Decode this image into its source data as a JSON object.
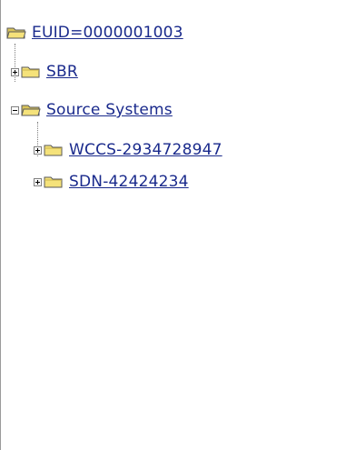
{
  "tree": {
    "root": {
      "label": "EUID=0000001003",
      "icon": "open-folder-icon"
    },
    "sbr": {
      "label": "SBR",
      "icon": "folder-icon",
      "toggle": "plus"
    },
    "source_systems": {
      "label": "Source Systems",
      "icon": "open-folder-icon",
      "toggle": "minus",
      "children": [
        {
          "label": "WCCS-2934728947",
          "icon": "folder-icon",
          "toggle": "plus"
        },
        {
          "label": "SDN-42424234",
          "icon": "folder-icon",
          "toggle": "plus"
        }
      ]
    }
  },
  "colors": {
    "link": "#1a2a8c",
    "folder_fill": "#f5e27a",
    "folder_outline": "#5a5a5a"
  }
}
